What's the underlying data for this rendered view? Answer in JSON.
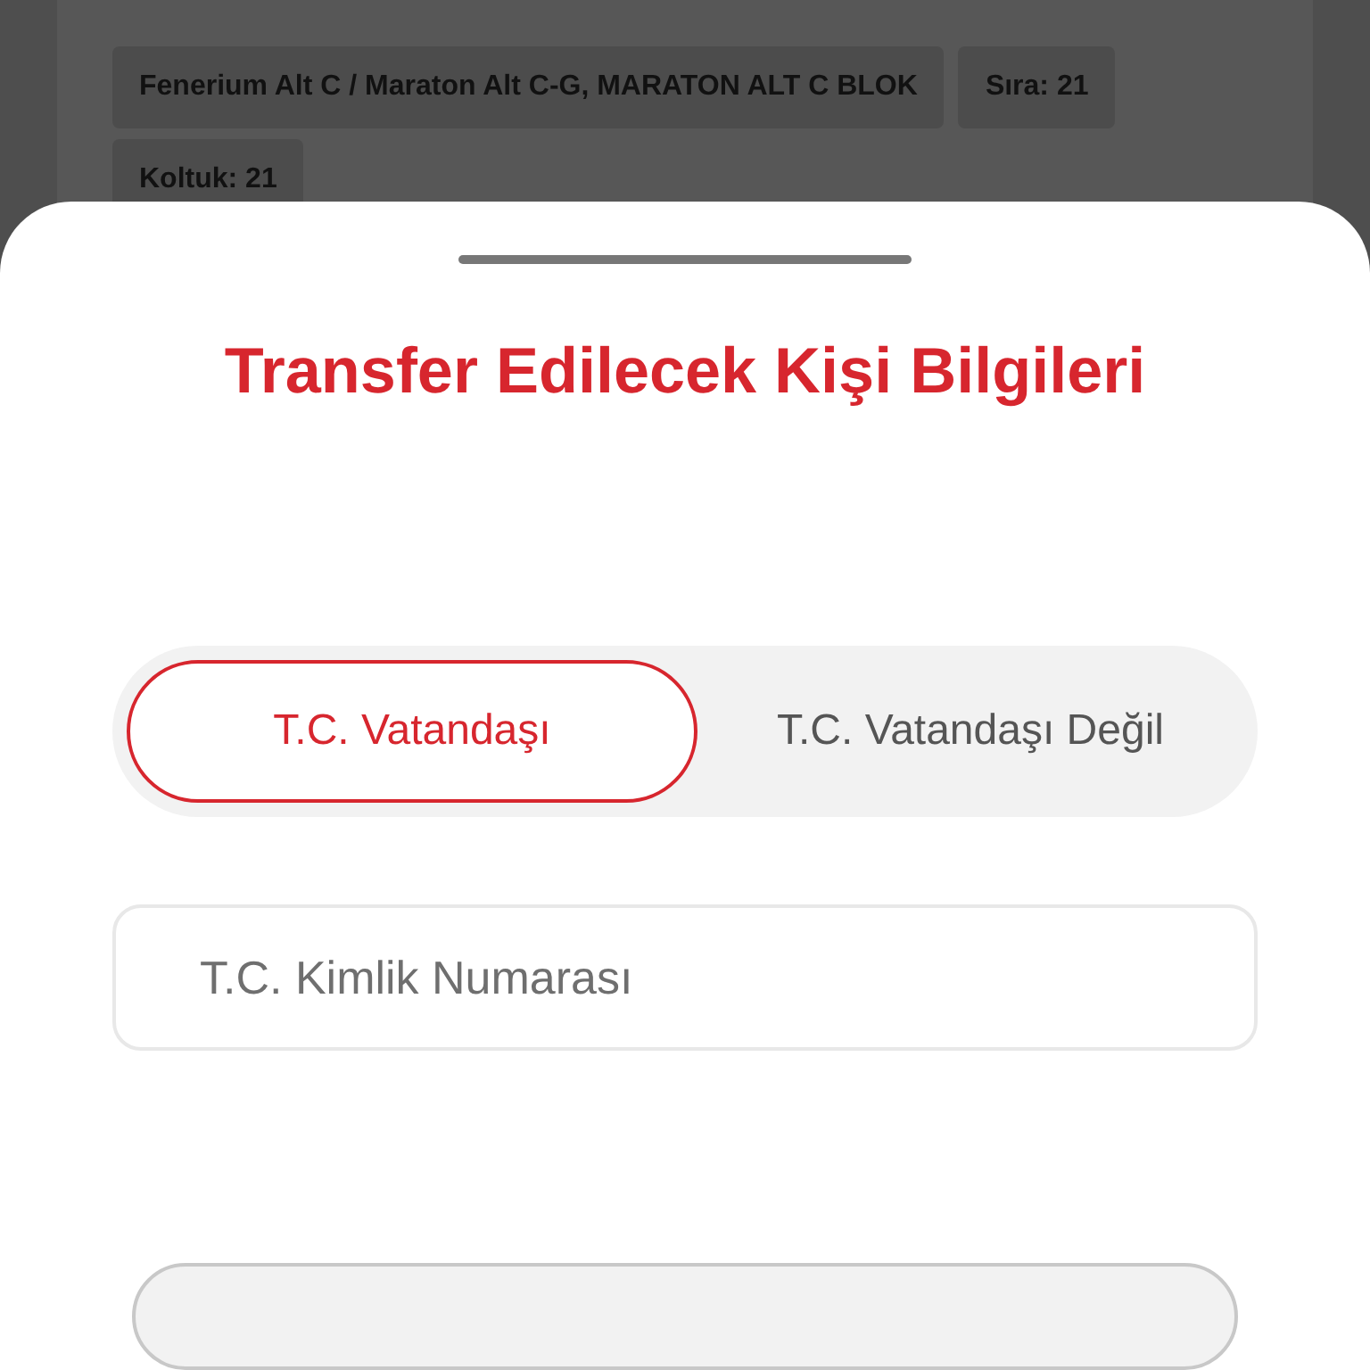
{
  "ticket_chips": [
    {
      "label": "Fenerium Alt C / Maraton Alt C-G, MARATON ALT C BLOK"
    },
    {
      "label": "Sıra: 21"
    },
    {
      "label": "Koltuk: 21"
    }
  ],
  "sheet": {
    "title": "Transfer Edilecek Kişi Bilgileri",
    "citizenship_tabs": [
      {
        "label": "T.C. Vatandaşı",
        "selected": true
      },
      {
        "label": "T.C. Vatandaşı Değil",
        "selected": false
      }
    ],
    "id_field": {
      "placeholder": "T.C. Kimlik Numarası"
    }
  }
}
